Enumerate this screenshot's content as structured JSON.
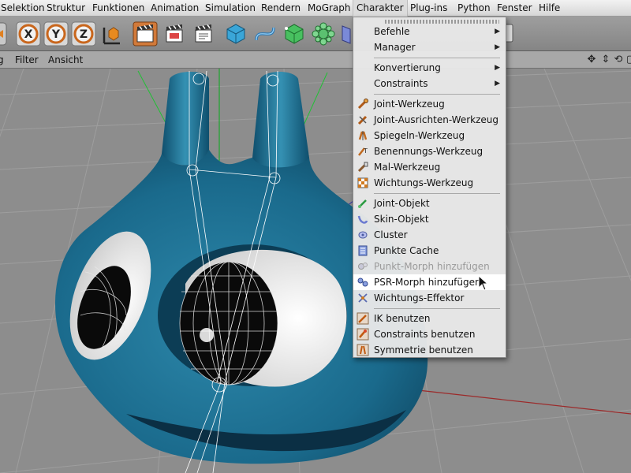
{
  "menubar": {
    "items": [
      {
        "label": "Selektion"
      },
      {
        "label": "Struktur"
      },
      {
        "label": "Funktionen"
      },
      {
        "label": "Animation"
      },
      {
        "label": "Simulation"
      },
      {
        "label": "Rendern"
      },
      {
        "label": "MoGraph"
      },
      {
        "label": "Charakter"
      },
      {
        "label": "Plug-ins"
      },
      {
        "label": "Python"
      },
      {
        "label": "Fenster"
      },
      {
        "label": "Hilfe"
      }
    ],
    "active": "Charakter"
  },
  "toolbar": {
    "axis_x": "X",
    "axis_y": "Y",
    "axis_z": "Z",
    "icons": [
      "move-icon",
      "axis-x-icon",
      "axis-y-icon",
      "axis-z-icon",
      "coordinate-system-icon",
      "render-view-icon",
      "render-picture-viewer-icon",
      "render-settings-icon",
      "cube-icon",
      "spline-icon",
      "nurbs-icon",
      "deformer-icon",
      "scene-icon"
    ]
  },
  "viewport_header": {
    "filter_label": "Filter",
    "view_label": "Ansicht",
    "nav_icons": [
      "move-view-icon",
      "zoom-view-icon",
      "rotate-view-icon",
      "maximize-view-icon"
    ]
  },
  "dropdown": {
    "items": [
      {
        "label": "Befehle",
        "submenu": true
      },
      {
        "label": "Manager",
        "submenu": true
      },
      {
        "separator": true
      },
      {
        "label": "Konvertierung",
        "submenu": true
      },
      {
        "label": "Constraints",
        "submenu": true
      },
      {
        "separator": true
      },
      {
        "label": "Joint-Werkzeug",
        "icon": "joint-tool-icon"
      },
      {
        "label": "Joint-Ausrichten-Werkzeug",
        "icon": "joint-align-tool-icon"
      },
      {
        "label": "Spiegeln-Werkzeug",
        "icon": "mirror-tool-icon"
      },
      {
        "label": "Benennungs-Werkzeug",
        "icon": "naming-tool-icon"
      },
      {
        "label": "Mal-Werkzeug",
        "icon": "paint-tool-icon"
      },
      {
        "label": "Wichtungs-Werkzeug",
        "icon": "weight-tool-icon"
      },
      {
        "separator": true
      },
      {
        "label": "Joint-Objekt",
        "icon": "joint-object-icon"
      },
      {
        "label": "Skin-Objekt",
        "icon": "skin-object-icon"
      },
      {
        "label": "Cluster",
        "icon": "cluster-icon"
      },
      {
        "label": "Punkte Cache",
        "icon": "point-cache-icon"
      },
      {
        "label": "Punkt-Morph hinzufügen",
        "icon": "point-morph-icon",
        "disabled": true
      },
      {
        "label": "PSR-Morph hinzufügen",
        "icon": "psr-morph-icon",
        "highlighted": true
      },
      {
        "label": "Wichtungs-Effektor",
        "icon": "weight-effector-icon"
      },
      {
        "separator": true
      },
      {
        "label": "IK benutzen",
        "icon": "use-ik-icon"
      },
      {
        "label": "Constraints benutzen",
        "icon": "use-constraints-icon"
      },
      {
        "label": "Symmetrie benutzen",
        "icon": "use-symmetry-icon"
      }
    ]
  },
  "colors": {
    "character_blue": "#1f6f8f",
    "menu_highlight": "#ffffff",
    "viewport_bg": "#8d8d8d"
  }
}
